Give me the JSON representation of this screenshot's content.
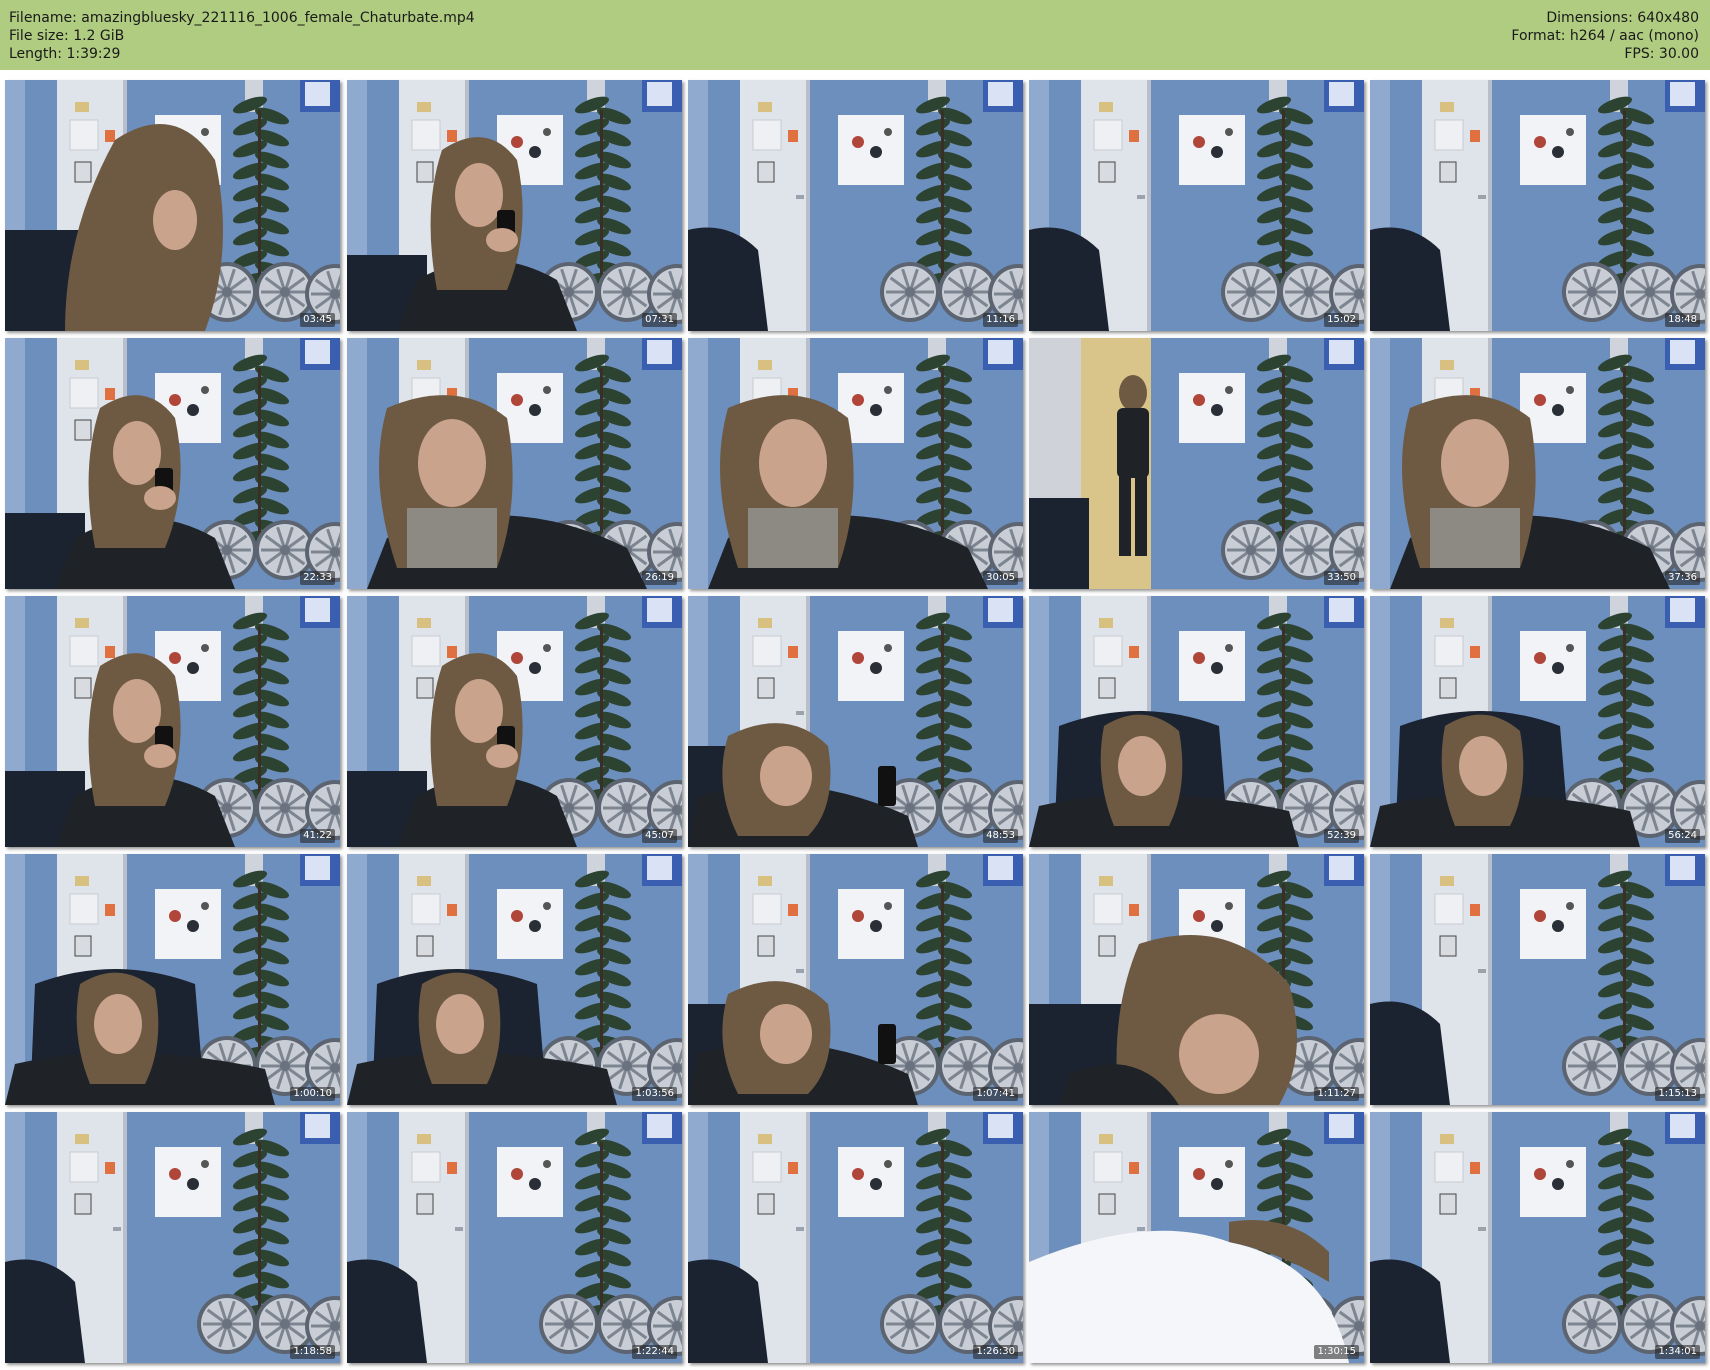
{
  "header": {
    "filename": "Filename: amazingbluesky_221116_1006_female_Chaturbate.mp4",
    "filesize": "File size: 1.2 GiB",
    "length": "Length: 1:39:29",
    "dimensions": "Dimensions: 640x480",
    "format": "Format: h264 / aac (mono)",
    "fps": "FPS: 30.00"
  },
  "colors": {
    "header_bg": "#b0cc80",
    "wall": "#6d8fbd",
    "door": "#dfe3ea"
  },
  "thumbnails": [
    {
      "timestamp": "03:45",
      "person": "hair-down"
    },
    {
      "timestamp": "07:31",
      "person": "phone"
    },
    {
      "timestamp": "11:16",
      "person": "none"
    },
    {
      "timestamp": "15:02",
      "person": "none"
    },
    {
      "timestamp": "18:48",
      "person": "none"
    },
    {
      "timestamp": "22:33",
      "person": "phone"
    },
    {
      "timestamp": "26:19",
      "person": "close"
    },
    {
      "timestamp": "30:05",
      "person": "close"
    },
    {
      "timestamp": "33:50",
      "person": "standing"
    },
    {
      "timestamp": "37:36",
      "person": "close"
    },
    {
      "timestamp": "41:22",
      "person": "phone"
    },
    {
      "timestamp": "45:07",
      "person": "phone"
    },
    {
      "timestamp": "48:53",
      "person": "leaning"
    },
    {
      "timestamp": "52:39",
      "person": "chair"
    },
    {
      "timestamp": "56:24",
      "person": "chair"
    },
    {
      "timestamp": "1:00:10",
      "person": "chair"
    },
    {
      "timestamp": "1:03:56",
      "person": "chair"
    },
    {
      "timestamp": "1:07:41",
      "person": "leaning"
    },
    {
      "timestamp": "1:11:27",
      "person": "head-close"
    },
    {
      "timestamp": "1:15:13",
      "person": "none"
    },
    {
      "timestamp": "1:18:58",
      "person": "none"
    },
    {
      "timestamp": "1:22:44",
      "person": "none"
    },
    {
      "timestamp": "1:26:30",
      "person": "none"
    },
    {
      "timestamp": "1:30:15",
      "person": "blanket"
    },
    {
      "timestamp": "1:34:01",
      "person": "none"
    }
  ]
}
